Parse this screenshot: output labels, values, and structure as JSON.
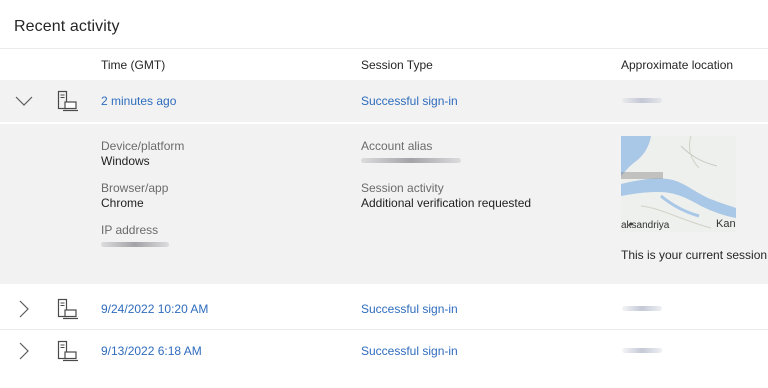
{
  "page": {
    "title": "Recent activity"
  },
  "table": {
    "headers": {
      "time": "Time (GMT)",
      "session_type": "Session Type",
      "location": "Approximate location"
    },
    "rows": [
      {
        "time": "2 minutes ago",
        "session_type": "Successful sign-in",
        "expanded": true,
        "device_icon": "device-icon"
      },
      {
        "time": "9/24/2022 10:20 AM",
        "session_type": "Successful sign-in",
        "expanded": false,
        "device_icon": "device-icon"
      },
      {
        "time": "9/13/2022 6:18 AM",
        "session_type": "Successful sign-in",
        "expanded": false,
        "device_icon": "device-icon"
      }
    ]
  },
  "details": {
    "device_platform_label": "Device/platform",
    "device_platform": "Windows",
    "browser_app_label": "Browser/app",
    "browser_app": "Chrome",
    "ip_address_label": "IP address",
    "account_alias_label": "Account alias",
    "session_activity_label": "Session activity",
    "session_activity": "Additional verification requested",
    "map_label_left": "aksandriya",
    "map_label_right": "Kan",
    "current_session": "This is your current session."
  },
  "colors": {
    "link": "#2f6cbd",
    "expanded_bg": "#f2f2f2",
    "text": "#262626",
    "label": "#6b6b6b"
  }
}
